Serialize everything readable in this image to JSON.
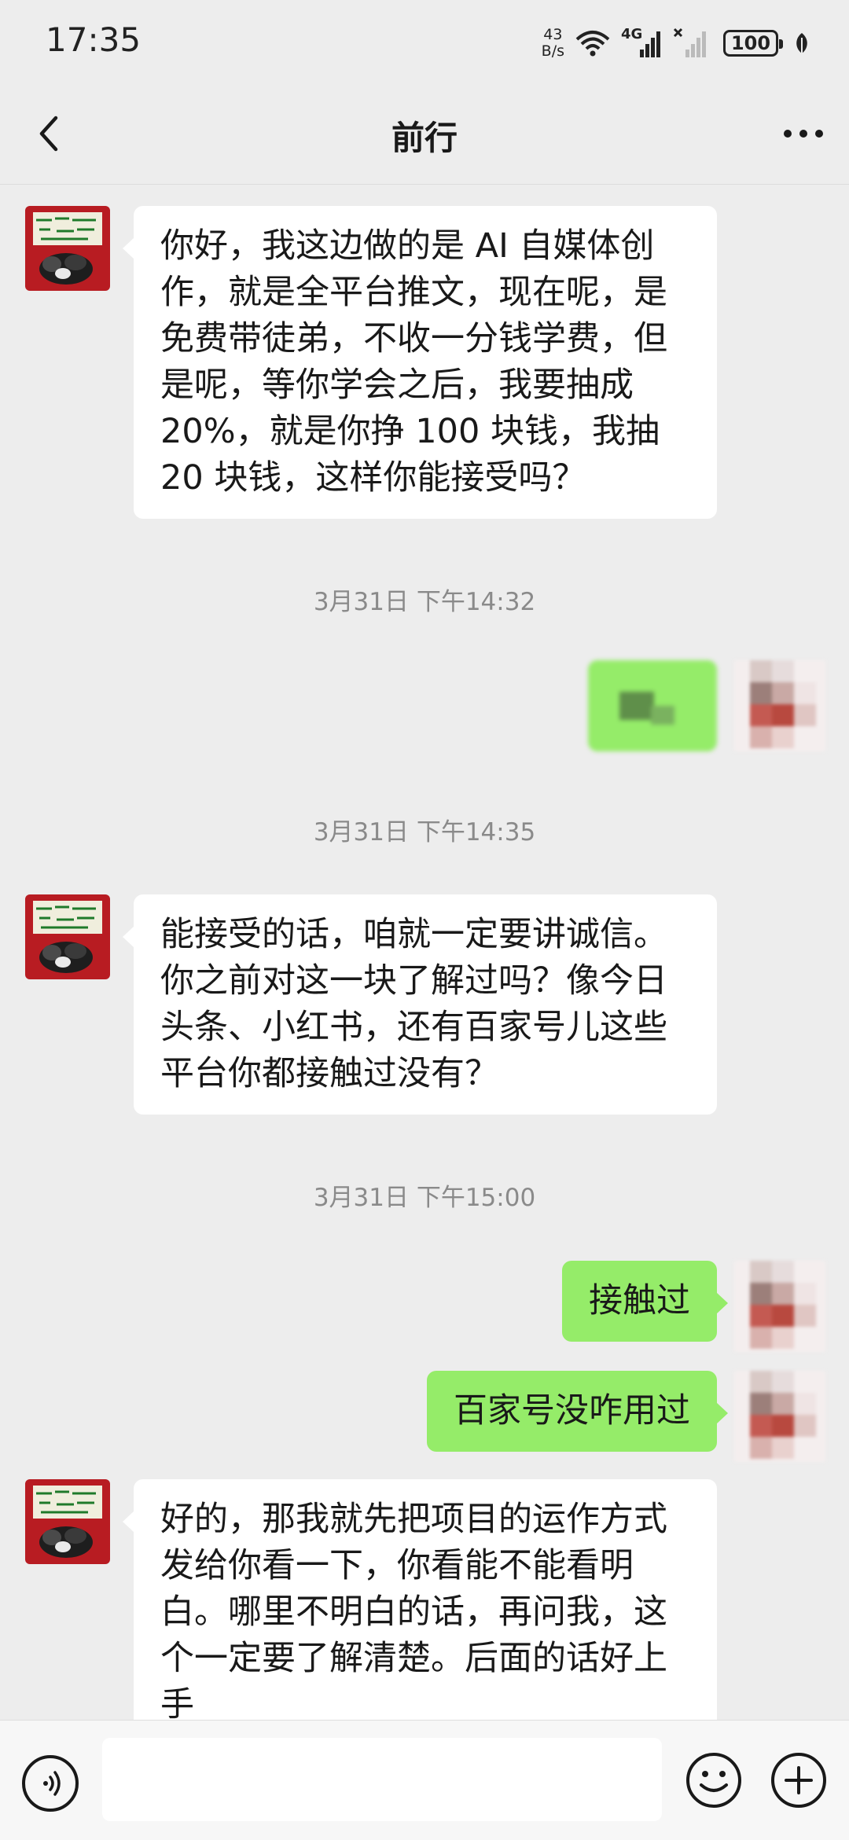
{
  "status_bar": {
    "time": "17:35",
    "net_speed_value": "43",
    "net_speed_unit": "B/s",
    "network": "4G",
    "battery": "100",
    "icons": [
      "wifi-icon",
      "signal-4g-icon",
      "signal-no-sim-icon",
      "battery-icon",
      "leaf-icon"
    ]
  },
  "nav": {
    "title": "前行",
    "back_icon": "chevron-left-icon",
    "more_icon": "more-dots-icon"
  },
  "messages": [
    {
      "type": "incoming",
      "text": "你好，我这边做的是 AI 自媒体创作，就是全平台推文，现在呢，是免费带徒弟，不收一分钱学费，但是呢，等你学会之后，我要抽成 20%，就是你挣 100 块钱，我抽 20 块钱，这样你能接受吗？"
    },
    {
      "type": "timestamp",
      "text": "3月31日 下午14:32"
    },
    {
      "type": "outgoing",
      "text": "",
      "note": "blurred image"
    },
    {
      "type": "timestamp",
      "text": "3月31日 下午14:35"
    },
    {
      "type": "incoming",
      "text": "能接受的话，咱就一定要讲诚信。你之前对这一块了解过吗？像今日头条、小红书，还有百家号儿这些平台你都接触过没有？"
    },
    {
      "type": "timestamp",
      "text": "3月31日 下午15:00"
    },
    {
      "type": "outgoing",
      "text": "接触过"
    },
    {
      "type": "outgoing",
      "text": "百家号没咋用过"
    },
    {
      "type": "incoming",
      "text": "好的，那我就先把项目的运作方式发给你看一下，你看能不能看明白。哪里不明白的话，再问我，这个一定要了解清楚。后面的话好上手"
    }
  ],
  "input_bar": {
    "placeholder": "",
    "voice_icon": "voice-icon",
    "emoji_icon": "emoji-icon",
    "plus_icon": "plus-icon"
  },
  "colors": {
    "background": "#ededed",
    "incoming_bubble": "#ffffff",
    "outgoing_bubble": "#95ec69",
    "timestamp_text": "#8a8a8a"
  }
}
